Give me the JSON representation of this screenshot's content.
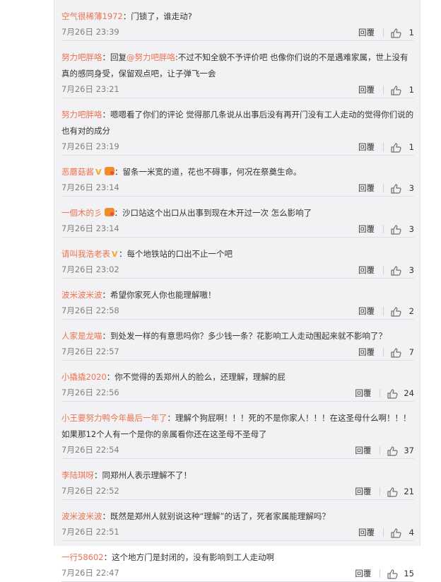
{
  "ui": {
    "reply_label": "回覆",
    "like_icon": "thumbs-up-icon",
    "accent": "#eb7350"
  },
  "comments": [
    {
      "user": "空气很稀薄1972",
      "badges": [],
      "segments": [
        {
          "text": "：门锁了，谁走动?"
        }
      ],
      "time": "7月26日 23:39",
      "likes": "1"
    },
    {
      "user": "努力吧胖咯",
      "badges": [],
      "segments": [
        {
          "text": "：回复"
        },
        {
          "text": "@努力吧胖咯",
          "mention": true
        },
        {
          "text": ":不过不知全貌不予评价吧 也像你们说的不是遇难家属，世上没有真的感同身受，保留观点吧，让子弹飞一会"
        }
      ],
      "time": "7月26日 23:21",
      "likes": "1"
    },
    {
      "user": "努力吧胖咯",
      "badges": [],
      "segments": [
        {
          "text": "：嗯嗯看了你们的评论 觉得那几条说从出事后没有再开门没有工人走动的觉得你们说的也有对的成分"
        }
      ],
      "time": "7月26日 23:19",
      "likes": "1"
    },
    {
      "user": "恶蘑菇酱",
      "badges": [
        "v",
        "h"
      ],
      "segments": [
        {
          "text": "：留条一米宽的道，花也不碍事，何况在祭奠生命。"
        }
      ],
      "time": "7月26日 23:14",
      "likes": "3"
    },
    {
      "user": "一個木的彡",
      "badges": [
        "h"
      ],
      "segments": [
        {
          "text": "：沙口站这个出口从出事到现在木开过一次 怎么影响了"
        }
      ],
      "time": "7月26日 23:14",
      "likes": "3"
    },
    {
      "user": "请叫我浩老表",
      "badges": [
        "v"
      ],
      "segments": [
        {
          "text": "：每个地铁站的口出不止一个吧"
        }
      ],
      "time": "7月26日 23:02",
      "likes": "3"
    },
    {
      "user": "波米波米波",
      "badges": [],
      "segments": [
        {
          "text": "：希望你家死人你也能理解嗷！"
        }
      ],
      "time": "7月26日 22:58",
      "likes": "2"
    },
    {
      "user": "人家是龙喵",
      "badges": [],
      "segments": [
        {
          "text": "：到处发一样的有意思吗你？多少钱一条？花影响工人走动围起来就不影响了？"
        }
      ],
      "time": "7月26日 22:57",
      "likes": "7"
    },
    {
      "user": "小撬撬2020",
      "badges": [],
      "segments": [
        {
          "text": "：你不觉得的丢郑州人的脸么，还理解，理解的屁"
        }
      ],
      "time": "7月26日 22:56",
      "likes": "24"
    },
    {
      "user": "小王要努力鸭今年最后一年了",
      "badges": [],
      "segments": [
        {
          "text": "：理解个狗屁啊！！！死的不是你家人！！！在这圣母什么啊！！！如果那12个人有一个是你的亲属看你还在这圣母不圣母了"
        }
      ],
      "time": "7月26日 22:54",
      "likes": "37"
    },
    {
      "user": "李陆琪呀",
      "badges": [],
      "segments": [
        {
          "text": "：同郑州人表示理解不了！"
        }
      ],
      "time": "7月26日 22:52",
      "likes": "21"
    },
    {
      "user": "波米波米波",
      "badges": [],
      "segments": [
        {
          "text": "：既然是郑州人就别说这种“理解”的话了，死者家属能理解吗？"
        }
      ],
      "time": "7月26日 22:51",
      "likes": "4"
    },
    {
      "user": "一行58602",
      "badges": [],
      "segments": [
        {
          "text": "：这个地方门是封闭的，没有影响到工人走动啊"
        }
      ],
      "time": "7月26日 22:47",
      "likes": "15"
    }
  ]
}
